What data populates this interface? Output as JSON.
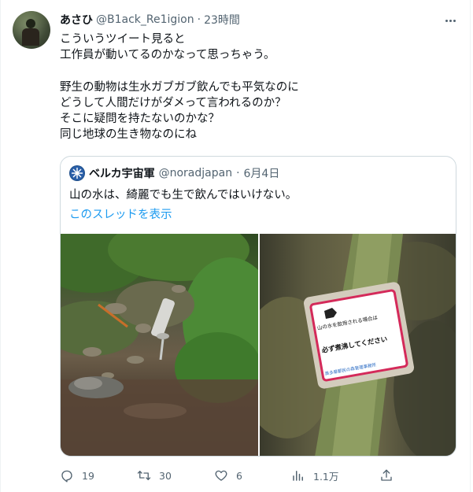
{
  "tweet": {
    "author_name": "あさひ",
    "handle": "@B1ack_Re1igion",
    "separator": "·",
    "time": "23時間",
    "lines": [
      "こういうツイート見ると",
      "工作員が動いてるのかなって思っちゃう。",
      "",
      "野生の動物は生水ガブガブ飲んでも平気なのに",
      "どうして人間だけがダメって言われるのか？",
      "そこに疑問を持たないのかな？",
      "同じ地球の生き物なのにね"
    ]
  },
  "quoted": {
    "author_name": "ベルカ宇宙軍",
    "handle": "@noradjapan",
    "separator": "·",
    "date": "6月4日",
    "text": "山の水は、綺麗でも生で飲んではいけない。",
    "thread_link": "このスレッドを表示"
  },
  "sign": {
    "line1": "山の水を飲用される場合は",
    "line2": "必ず煮沸してください",
    "footer": "奥多摩都民の森管理事務所"
  },
  "actions": {
    "reply_count": "19",
    "retweet_count": "30",
    "like_count": "6",
    "view_count": "1.1万"
  },
  "colors": {
    "text": "#0f1419",
    "secondary": "#536471",
    "link": "#1d9bf0",
    "border": "#cfd9de"
  },
  "icons": [
    "more-icon",
    "reply-icon",
    "retweet-icon",
    "like-icon",
    "views-icon",
    "share-icon"
  ]
}
